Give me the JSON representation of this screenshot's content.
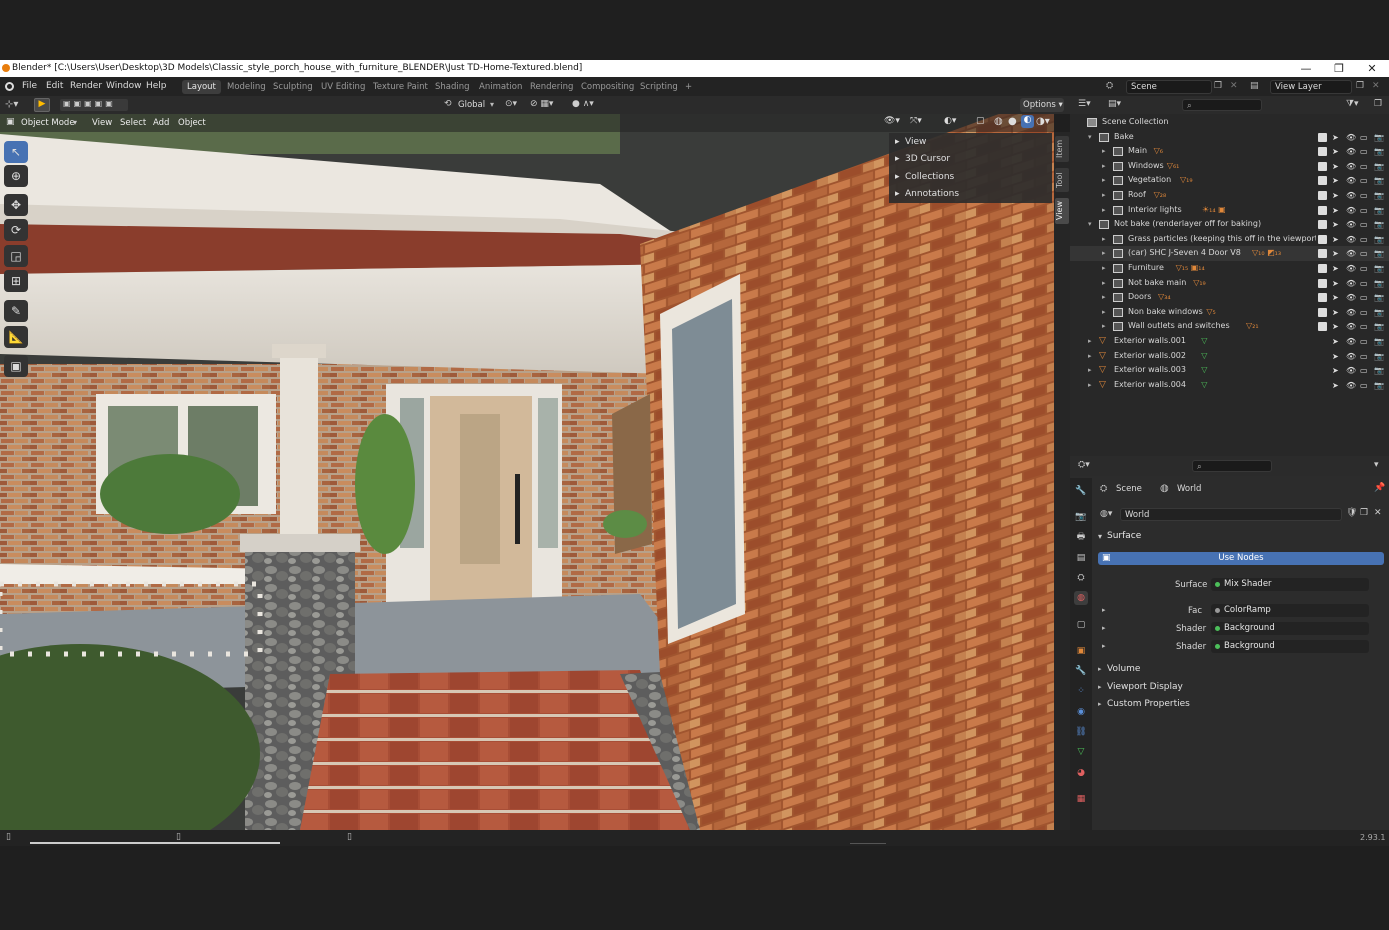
{
  "window": {
    "title": "Blender* [C:\\Users\\User\\Desktop\\3D Models\\Classic_style_porch_house_with_furniture_BLENDER\\Just TD-Home-Textured.blend]",
    "minimize": "—",
    "restore": "❐",
    "close": "✕"
  },
  "menus": [
    "File",
    "Edit",
    "Render",
    "Window",
    "Help"
  ],
  "workspaces": [
    "Layout",
    "Modeling",
    "Sculpting",
    "UV Editing",
    "Texture Paint",
    "Shading",
    "Animation",
    "Rendering",
    "Compositing",
    "Scripting"
  ],
  "workspace_add": "+",
  "scene_field": "Scene",
  "view_layer_field": "View Layer",
  "viewport": {
    "transform_orientation": "Global",
    "options_label": "Options",
    "mode": "Object Mode",
    "header_menus": [
      "View",
      "Select",
      "Add",
      "Object"
    ],
    "sidebar_sections": [
      "View",
      "3D Cursor",
      "Collections",
      "Annotations"
    ],
    "side_tabs": [
      "Item",
      "Tool",
      "View"
    ],
    "tools": [
      "select-box-icon",
      "cursor-icon",
      "move-icon",
      "rotate-icon",
      "scale-icon",
      "transform-icon",
      "annotate-icon",
      "measure-icon",
      "add-cube-icon"
    ]
  },
  "outliner": {
    "root": "Scene Collection",
    "rows": [
      {
        "label": "Bake",
        "depth": 1,
        "type": "collection",
        "expanded": true,
        "badge": "",
        "checkbox": true
      },
      {
        "label": "Main",
        "depth": 2,
        "type": "collection",
        "expanded": false,
        "badge": "▽₆",
        "checkbox": true
      },
      {
        "label": "Windows",
        "depth": 2,
        "type": "collection",
        "expanded": false,
        "badge": "▽₆₁",
        "checkbox": true
      },
      {
        "label": "Vegetation",
        "depth": 2,
        "type": "collection",
        "expanded": false,
        "badge": "▽₁₉",
        "checkbox": true
      },
      {
        "label": "Roof",
        "depth": 2,
        "type": "collection",
        "expanded": false,
        "badge": "▽₂₈",
        "checkbox": true
      },
      {
        "label": "Interior lights",
        "depth": 2,
        "type": "collection",
        "expanded": false,
        "badge": "☀₁₄ ▣",
        "checkbox": true
      },
      {
        "label": "Not bake (renderlayer off for baking)",
        "depth": 1,
        "type": "collection",
        "expanded": true,
        "badge": "",
        "checkbox": true
      },
      {
        "label": "Grass particles (keeping this off in the viewport re",
        "depth": 2,
        "type": "collection",
        "expanded": false,
        "badge": "",
        "checkbox": true
      },
      {
        "label": "(car) SHC J-Seven 4 Door V8",
        "depth": 2,
        "type": "collection",
        "expanded": false,
        "badge": "▽₁₀ ◩₁₃",
        "checkbox": true,
        "selected": true
      },
      {
        "label": "Furniture",
        "depth": 2,
        "type": "collection",
        "expanded": false,
        "badge": "▽₁₅ ▣₁₄",
        "checkbox": true
      },
      {
        "label": "Not bake main",
        "depth": 2,
        "type": "collection",
        "expanded": false,
        "badge": "▽₁₉",
        "checkbox": true
      },
      {
        "label": "Doors",
        "depth": 2,
        "type": "collection",
        "expanded": false,
        "badge": "▽₃₄",
        "checkbox": true
      },
      {
        "label": "Non bake windows",
        "depth": 2,
        "type": "collection",
        "expanded": false,
        "badge": "▽₅",
        "checkbox": true
      },
      {
        "label": "Wall outlets and switches",
        "depth": 2,
        "type": "collection",
        "expanded": false,
        "badge": "▽₂₁",
        "checkbox": true
      },
      {
        "label": "Exterior walls.001",
        "depth": 1,
        "type": "object",
        "expanded": false,
        "badge": "▽",
        "checkbox": false
      },
      {
        "label": "Exterior walls.002",
        "depth": 1,
        "type": "object",
        "expanded": false,
        "badge": "▽",
        "checkbox": false
      },
      {
        "label": "Exterior walls.003",
        "depth": 1,
        "type": "object",
        "expanded": false,
        "badge": "▽",
        "checkbox": false
      },
      {
        "label": "Exterior walls.004",
        "depth": 1,
        "type": "object",
        "expanded": false,
        "badge": "▽",
        "checkbox": false
      }
    ]
  },
  "properties": {
    "breadcrumb_scene": "Scene",
    "breadcrumb_world": "World",
    "world_name": "World",
    "surface_panel": "Surface",
    "use_nodes": "Use Nodes",
    "surface_label": "Surface",
    "surface_value": "Mix Shader",
    "fac_label": "Fac",
    "fac_value": "ColorRamp",
    "shader1_label": "Shader",
    "shader1_value": "Background",
    "shader2_label": "Shader",
    "shader2_value": "Background",
    "collapsed_panels": [
      "Volume",
      "Viewport Display",
      "Custom Properties"
    ]
  },
  "status": {
    "version": "2.93.1"
  },
  "colors": {
    "accent": "#4772b3",
    "orange": "#e0883a",
    "green": "#4cbf5a"
  }
}
